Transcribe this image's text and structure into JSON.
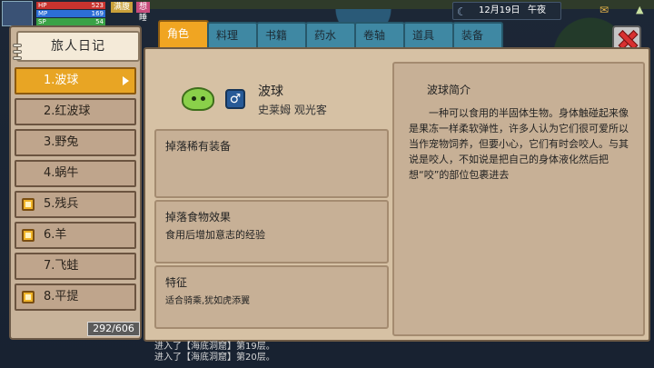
{
  "hud": {
    "stats": [
      {
        "label": "HP",
        "value": "523"
      },
      {
        "label": "MP",
        "value": "169"
      },
      {
        "label": "SP",
        "value": "54"
      }
    ],
    "tags": [
      "满腹",
      "想睡"
    ],
    "date": "12月19日",
    "time_of_day": "午夜"
  },
  "sidebar": {
    "title": "旅人日记",
    "entries": [
      {
        "label": "1.波球",
        "active": true,
        "badge": false
      },
      {
        "label": "2.红波球",
        "active": false,
        "badge": false
      },
      {
        "label": "3.野兔",
        "active": false,
        "badge": false
      },
      {
        "label": "4.蜗牛",
        "active": false,
        "badge": false
      },
      {
        "label": "5.残兵",
        "active": false,
        "badge": true
      },
      {
        "label": "6.羊",
        "active": false,
        "badge": true
      },
      {
        "label": "7.飞蛙",
        "active": false,
        "badge": false
      },
      {
        "label": "8.平提",
        "active": false,
        "badge": true
      }
    ],
    "count": "292/606"
  },
  "tabs": [
    "角色",
    "料理",
    "书籍",
    "药水",
    "卷轴",
    "道具",
    "装备"
  ],
  "active_tab": 0,
  "creature": {
    "name": "波球",
    "subtitle": "史莱姆 观光客",
    "gender_symbol": "♂"
  },
  "sections": {
    "drops_title": "掉落稀有装备",
    "drops_body": "",
    "food_title": "掉落食物效果",
    "food_body": "食用后增加意志的经验",
    "traits_title": "特征",
    "traits_body": "适合骑乘,犹如虎添翼"
  },
  "description": {
    "title": "波球简介",
    "body": "一种可以食用的半固体生物。身体触碰起来像是果冻一样柔软弹性，许多人认为它们很可爱所以当作宠物饲养，但要小心，它们有时会咬人。与其说是咬人，不如说是把自己的身体液化然后把想“咬”的部位包裹进去"
  },
  "log": [
    "进入了【海底洞窟】第19层。",
    "进入了【海底洞窟】第20层。"
  ],
  "colors": {
    "active_tab": "#f0a522",
    "tab": "#3f88a3",
    "page": "#d6c1a4",
    "close": "#d83030"
  }
}
